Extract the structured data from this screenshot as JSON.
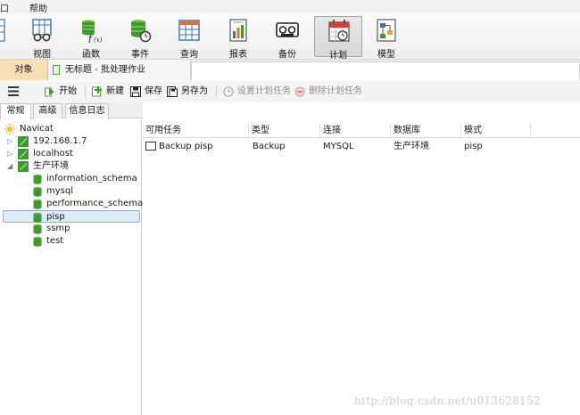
{
  "menubar": {
    "left_stub": "口",
    "help": "帮助"
  },
  "ribbon": {
    "items": [
      {
        "label": "视图",
        "icon": "view-icon"
      },
      {
        "label": "函数",
        "icon": "function-icon"
      },
      {
        "label": "事件",
        "icon": "event-icon"
      },
      {
        "label": "查询",
        "icon": "query-icon"
      },
      {
        "label": "报表",
        "icon": "report-icon"
      },
      {
        "label": "备份",
        "icon": "backup-icon"
      },
      {
        "label": "计划",
        "icon": "schedule-icon",
        "active": true
      },
      {
        "label": "模型",
        "icon": "model-icon"
      }
    ]
  },
  "tabs": {
    "objects": "对象",
    "document": "无标题 - 批处理作业"
  },
  "actions": {
    "start": "开始",
    "new": "新建",
    "save": "保存",
    "save_as": "另存为",
    "set_schedule": "设置计划任务",
    "delete_schedule": "删除计划任务"
  },
  "left_tabs": {
    "general": "常规",
    "advanced": "高级",
    "log": "信息日志"
  },
  "tree": {
    "root": "Navicat",
    "connections": [
      {
        "name": "192.168.1.7",
        "expanded": false
      },
      {
        "name": "localhost",
        "expanded": false
      },
      {
        "name": "生产环境",
        "expanded": true
      }
    ],
    "databases": [
      "information_schema",
      "mysql",
      "performance_schema",
      "pisp",
      "ssmp",
      "test"
    ],
    "selected": "pisp"
  },
  "table": {
    "columns": [
      "可用任务",
      "类型",
      "连接",
      "数据库",
      "模式"
    ],
    "rows": [
      {
        "task": "Backup pisp",
        "type": "Backup",
        "connection": "MYSQL",
        "database": "生产环境",
        "schema": "pisp"
      }
    ]
  },
  "watermark": "http://blog.csdn.net/u013628152",
  "colors": {
    "objects_tab": "#f8dfb4",
    "selection": "#dfeaf8",
    "db_icon": "#3f9a2c"
  }
}
